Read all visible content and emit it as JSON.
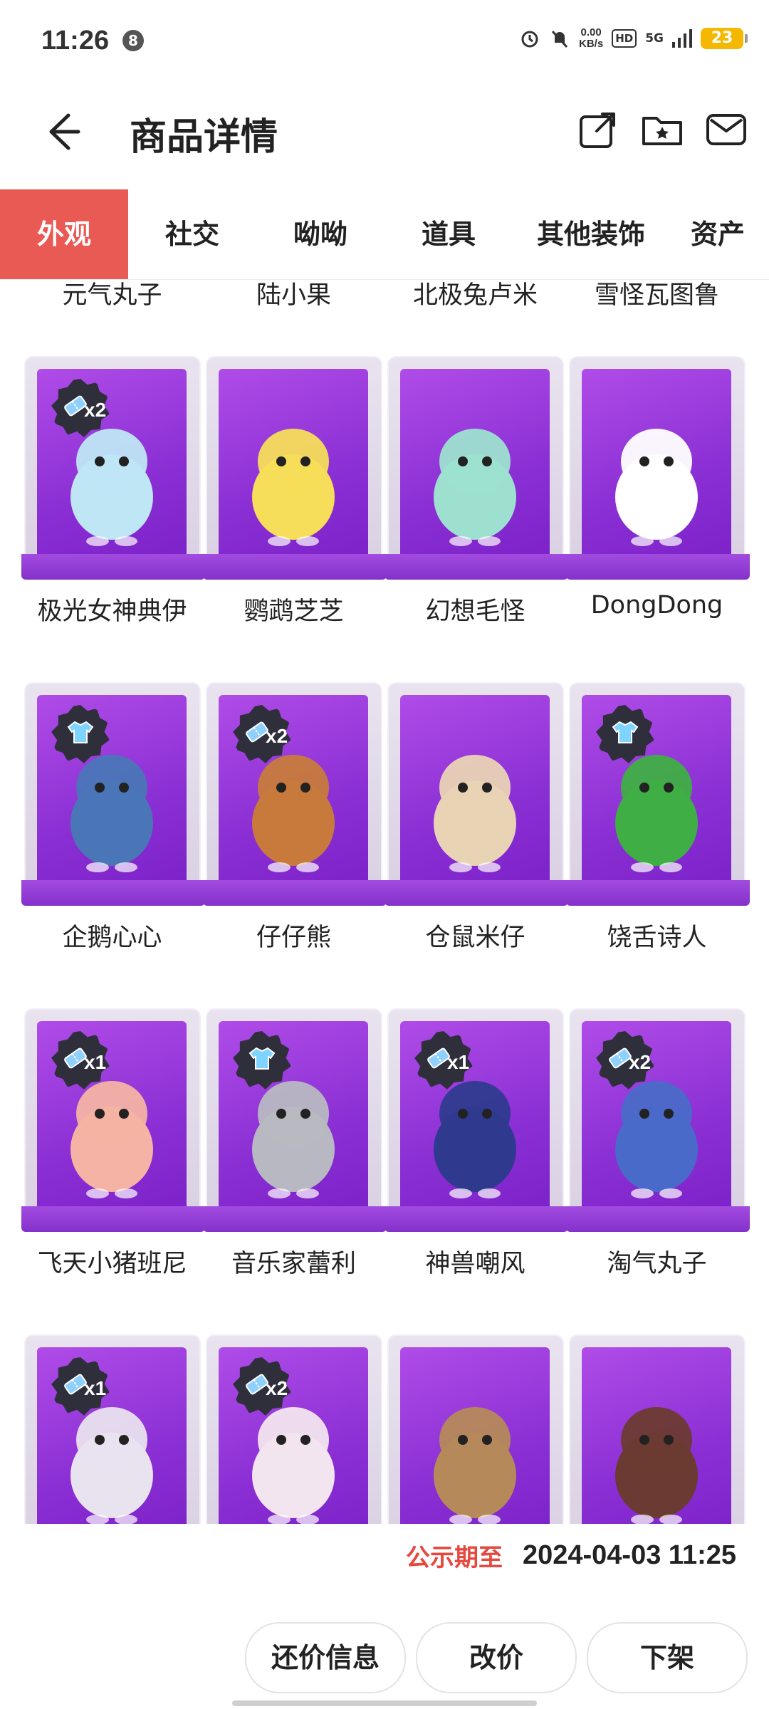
{
  "status_bar": {
    "time": "11:26",
    "notif_count": "8",
    "net_speed_value": "0.00",
    "net_speed_unit": "KB/s",
    "hd": "HD",
    "network": "5G",
    "battery": "23"
  },
  "header": {
    "title": "商品详情"
  },
  "tabs": [
    {
      "label": "外观",
      "active": true
    },
    {
      "label": "社交"
    },
    {
      "label": "呦呦"
    },
    {
      "label": "道具"
    },
    {
      "label": "其他装饰"
    },
    {
      "label": "资产"
    }
  ],
  "previous_row_names": [
    "元气丸子",
    "陆小果",
    "北极兔卢米",
    "雪怪瓦图鲁"
  ],
  "items": [
    {
      "name": "极光女神典伊",
      "badge": "x2",
      "badge_type": "ticket",
      "color": "#bfe6f5"
    },
    {
      "name": "鹦鹉芝芝",
      "badge": "",
      "badge_type": "",
      "color": "#f6dd5a"
    },
    {
      "name": "幻想毛怪",
      "badge": "",
      "badge_type": "",
      "color": "#9de0d0"
    },
    {
      "name": "DongDong",
      "badge": "",
      "badge_type": "",
      "color": "#ffffff"
    },
    {
      "name": "企鹅心心",
      "badge": "",
      "badge_type": "shirt",
      "color": "#4a76b8"
    },
    {
      "name": "仔仔熊",
      "badge": "x2",
      "badge_type": "ticket",
      "color": "#c77a3c"
    },
    {
      "name": "仓鼠米仔",
      "badge": "",
      "badge_type": "",
      "color": "#e9d3b5"
    },
    {
      "name": "饶舌诗人",
      "badge": "",
      "badge_type": "shirt",
      "color": "#3fae44"
    },
    {
      "name": "飞天小猪班尼",
      "badge": "x1",
      "badge_type": "ticket",
      "color": "#f4b3a4"
    },
    {
      "name": "音乐家蕾利",
      "badge": "",
      "badge_type": "shirt",
      "color": "#b8b8c2"
    },
    {
      "name": "神兽嘲风",
      "badge": "x1",
      "badge_type": "ticket",
      "color": "#2f3a8f"
    },
    {
      "name": "淘气丸子",
      "badge": "x2",
      "badge_type": "ticket",
      "color": "#4a6ac9"
    },
    {
      "name": "",
      "badge": "x1",
      "badge_type": "ticket",
      "color": "#e9e2ef"
    },
    {
      "name": "",
      "badge": "x2",
      "badge_type": "ticket",
      "color": "#f2e5ef"
    },
    {
      "name": "",
      "badge": "",
      "badge_type": "",
      "color": "#b5895a"
    },
    {
      "name": "",
      "badge": "",
      "badge_type": "",
      "color": "#6b3a32"
    }
  ],
  "bottom": {
    "deadline_label": "公示期至",
    "deadline_value": "2024-04-03 11:25",
    "buttons": {
      "counter_offer": "还价信息",
      "change_price": "改价",
      "delist": "下架"
    }
  }
}
